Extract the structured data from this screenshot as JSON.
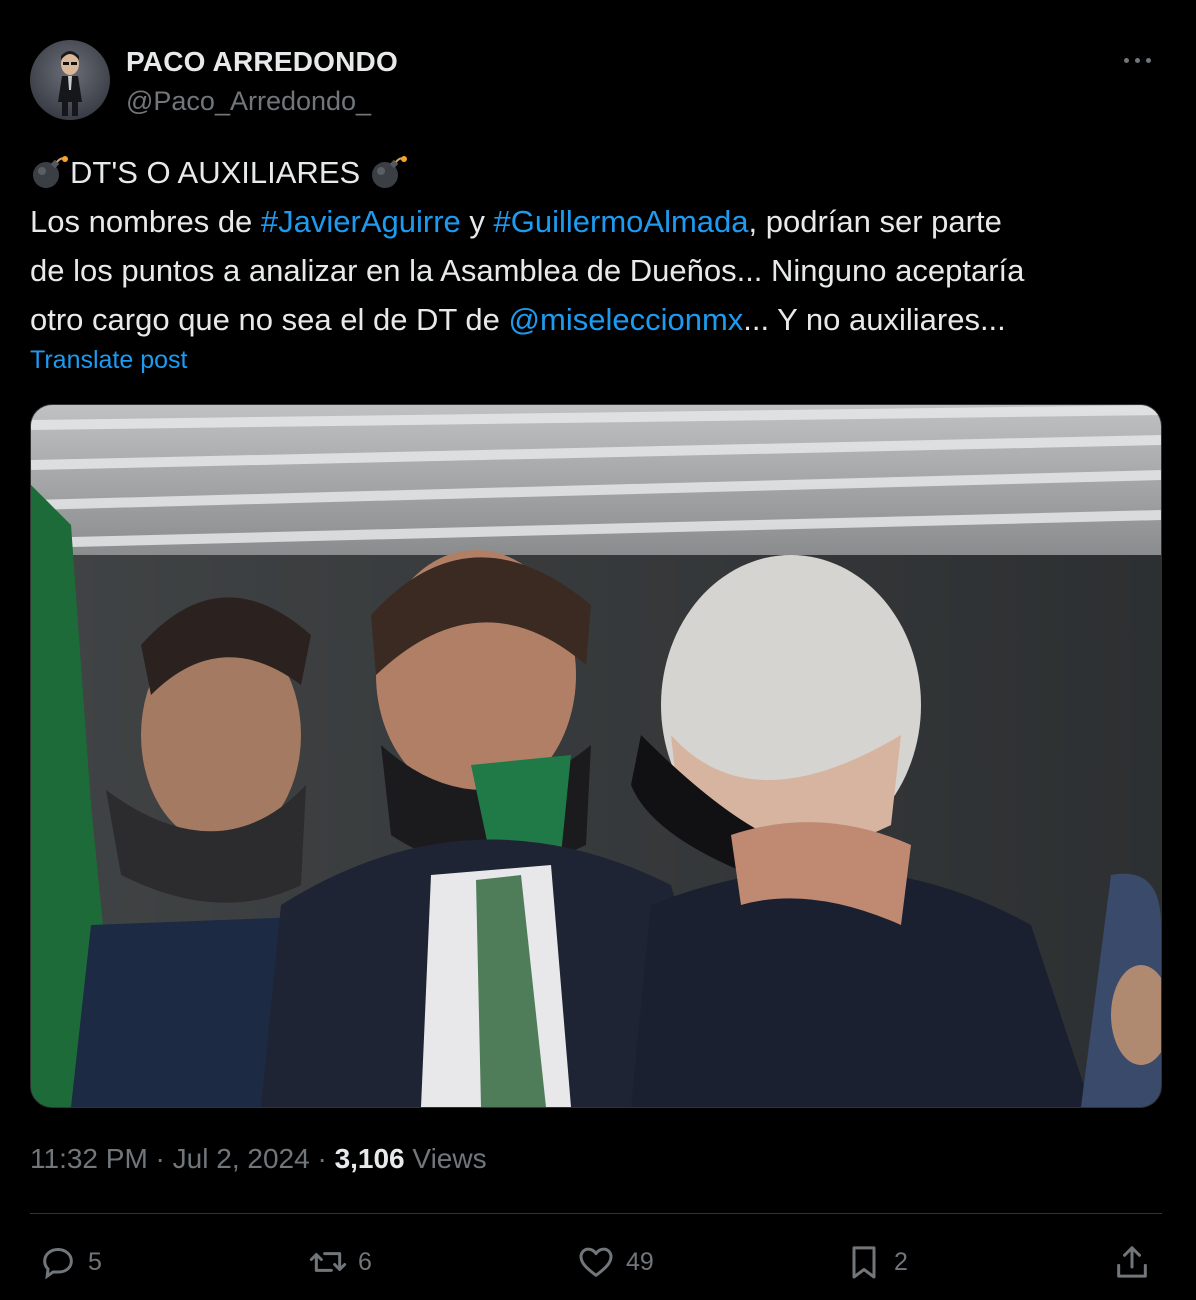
{
  "author": {
    "display_name": "PACO ARREDONDO",
    "handle": "@Paco_Arredondo_",
    "avatar_icon": "avatar-caricature"
  },
  "tweet": {
    "line1": {
      "emoji_left": "bomb-emoji",
      "text": "DT'S O AUXILIARES",
      "emoji_right": "bomb-emoji"
    },
    "line2": {
      "t1": "Los nombres de ",
      "link1": "#JavierAguirre",
      "t2": " y ",
      "link2": "#GuillermoAlmada",
      "t3": ", podrían ser parte"
    },
    "line3": {
      "text": "de los puntos a analizar en la Asamblea de Dueños... Ninguno aceptaría"
    },
    "line4": {
      "t1": "otro cargo que no sea el de DT de ",
      "link": "@miseleccionmx",
      "t2": "... Y no auxiliares..."
    },
    "translate_label": "Translate post"
  },
  "media": {
    "type": "photo"
  },
  "meta": {
    "time": "11:32 PM",
    "separator": " · ",
    "date": "Jul 2, 2024",
    "views_count": "3,106",
    "views_label": " Views"
  },
  "actions": {
    "replies": {
      "icon": "reply-icon",
      "count": "5"
    },
    "reposts": {
      "icon": "repost-icon",
      "count": "6"
    },
    "likes": {
      "icon": "heart-icon",
      "count": "49"
    },
    "bookmarks": {
      "icon": "bookmark-icon",
      "count": "2"
    },
    "share": {
      "icon": "share-icon"
    }
  },
  "colors": {
    "background": "#000000",
    "text": "#e7e9ea",
    "secondary": "#71767b",
    "link": "#1d9bf0",
    "border": "#2f3336"
  }
}
